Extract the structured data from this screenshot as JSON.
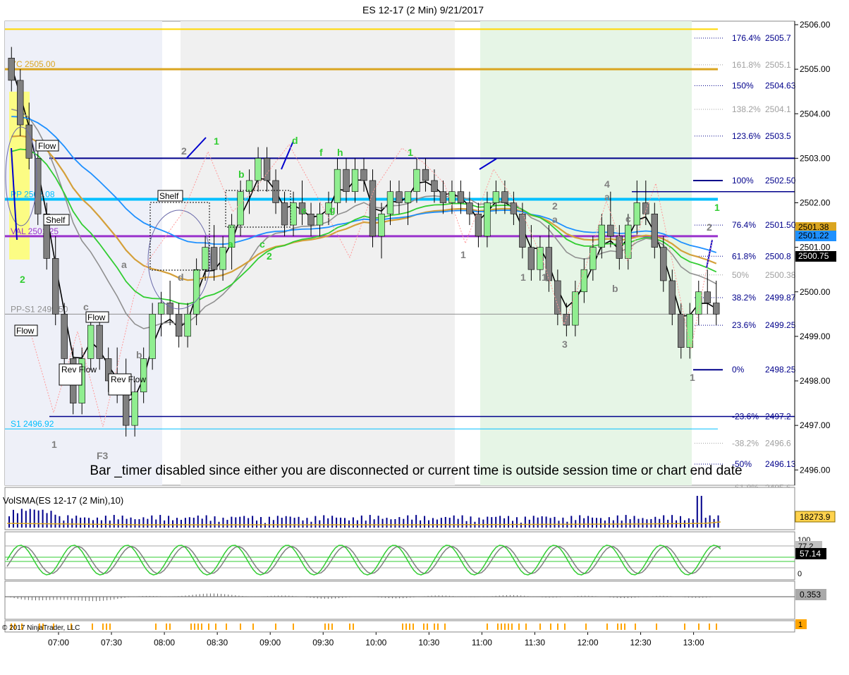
{
  "header": {
    "title": "ES 12-17 (2 Min)  9/21/2017"
  },
  "colors": {
    "up_bar": "#90ee90",
    "down_bar": "#808080",
    "fib": "#00008b",
    "cyan_line": "#00bfff",
    "purple_line": "#9932cc",
    "gold_line": "#daa520",
    "ema_fast": "#000000",
    "ema_green": "#32cd32",
    "ema_blue": "#1e90ff",
    "ema_gold": "#d4a03a",
    "ema_gray": "#909090"
  },
  "chart_data": {
    "type": "candlestick",
    "instrument": "ES 12-17 (2 Min)",
    "date": "9/21/2017",
    "ylim": [
      2495.75,
      2506.0
    ],
    "x_ticks": [
      "07:00",
      "07:30",
      "08:00",
      "08:30",
      "09:00",
      "09:30",
      "10:00",
      "10:30",
      "11:00",
      "11:30",
      "12:00",
      "12:30",
      "13:00"
    ],
    "y_ticks": [
      {
        "v": 2506,
        "label": "2506.00"
      },
      {
        "v": 2505,
        "label": "2505.00"
      },
      {
        "v": 2504,
        "label": "2504.00"
      },
      {
        "v": 2503,
        "label": "2503.00"
      },
      {
        "v": 2502,
        "label": "2502.00"
      },
      {
        "v": 2501,
        "label": "2501.00"
      },
      {
        "v": 2500,
        "label": "2500.00"
      },
      {
        "v": 2499,
        "label": "2499.00"
      },
      {
        "v": 2498,
        "label": "2498.00"
      },
      {
        "v": 2497,
        "label": "2497.00"
      },
      {
        "v": 2496,
        "label": "2496.00"
      }
    ],
    "price_tags": [
      {
        "v": 2501.38,
        "label": "2501.38",
        "bg": "#daa520",
        "fg": "#000000"
      },
      {
        "v": 2501.22,
        "label": "2501.22",
        "bg": "#1e90ff",
        "fg": "#000000"
      },
      {
        "v": 2500.75,
        "label": "2500.75",
        "bg": "#000000",
        "fg": "#ffffff"
      }
    ],
    "levels": [
      {
        "label": "YC 2505.00",
        "v": 2505.0,
        "color": "#daa520"
      },
      {
        "label": "PP 2502.08",
        "v": 2502.08,
        "color": "#00bfff"
      },
      {
        "label": "VAL 2501.25",
        "v": 2501.25,
        "color": "#9932cc"
      },
      {
        "label": "PP-S1 2499.50",
        "v": 2499.5,
        "color": "#909090"
      },
      {
        "label": "S1 2496.92",
        "v": 2496.92,
        "color": "#00bfff"
      }
    ],
    "fib_levels": [
      {
        "pct": "176.4%",
        "price": "2505.7"
      },
      {
        "pct": "161.8%",
        "price": "2505.1"
      },
      {
        "pct": "150%",
        "price": "2504.63"
      },
      {
        "pct": "138.2%",
        "price": "2504.1"
      },
      {
        "pct": "123.6%",
        "price": "2503.5"
      },
      {
        "pct": "100%",
        "price": "2502.50"
      },
      {
        "pct": "76.4%",
        "price": "2501.50"
      },
      {
        "pct": "61.8%",
        "price": "2500.8"
      },
      {
        "pct": "50%",
        "price": "2500.38"
      },
      {
        "pct": "38.2%",
        "price": "2499.87"
      },
      {
        "pct": "23.6%",
        "price": "2499.25"
      },
      {
        "pct": "0%",
        "price": "2498.25"
      },
      {
        "pct": "-23.6%",
        "price": "2497.2"
      },
      {
        "pct": "-38.2%",
        "price": "2496.6"
      },
      {
        "pct": "-50%",
        "price": "2496.13"
      },
      {
        "pct": "-61.8%",
        "price": "2495.6"
      }
    ],
    "annotations": [
      "Flow",
      "Shelf",
      "Shelf",
      "Flow",
      "Flow",
      "Rev Flow",
      "Rev Flow",
      "F3",
      "a",
      "b",
      "c",
      "d",
      "e",
      "f",
      "g",
      "h",
      "1",
      "2",
      "3",
      "4"
    ],
    "candles": [
      {
        "o": 2505.25,
        "h": 2505.5,
        "l": 2504.5,
        "c": 2504.75
      },
      {
        "o": 2504.75,
        "h": 2505.0,
        "l": 2503.5,
        "c": 2503.75
      },
      {
        "o": 2503.75,
        "h": 2504.25,
        "l": 2502.75,
        "c": 2503.0
      },
      {
        "o": 2503.0,
        "h": 2503.25,
        "l": 2501.5,
        "c": 2501.75
      },
      {
        "o": 2501.75,
        "h": 2502.0,
        "l": 2500.5,
        "c": 2500.75
      },
      {
        "o": 2500.75,
        "h": 2501.25,
        "l": 2499.25,
        "c": 2499.5
      },
      {
        "o": 2499.5,
        "h": 2499.75,
        "l": 2498.25,
        "c": 2498.5
      },
      {
        "o": 2498.5,
        "h": 2498.75,
        "l": 2497.25,
        "c": 2497.5
      },
      {
        "o": 2497.5,
        "h": 2498.75,
        "l": 2497.25,
        "c": 2498.5
      },
      {
        "o": 2498.5,
        "h": 2499.5,
        "l": 2498.25,
        "c": 2499.25
      },
      {
        "o": 2499.25,
        "h": 2499.5,
        "l": 2498.25,
        "c": 2498.5
      },
      {
        "o": 2498.5,
        "h": 2498.75,
        "l": 2497.75,
        "c": 2498.0
      },
      {
        "o": 2498.0,
        "h": 2498.75,
        "l": 2497.5,
        "c": 2497.75
      },
      {
        "o": 2497.75,
        "h": 2498.5,
        "l": 2496.75,
        "c": 2497.0
      },
      {
        "o": 2497.0,
        "h": 2498.0,
        "l": 2496.75,
        "c": 2497.75
      },
      {
        "o": 2497.75,
        "h": 2498.75,
        "l": 2497.5,
        "c": 2498.5
      },
      {
        "o": 2498.5,
        "h": 2499.75,
        "l": 2498.25,
        "c": 2499.5
      },
      {
        "o": 2499.5,
        "h": 2500.0,
        "l": 2499.0,
        "c": 2499.75
      },
      {
        "o": 2499.75,
        "h": 2500.25,
        "l": 2499.25,
        "c": 2499.5
      },
      {
        "o": 2499.5,
        "h": 2499.75,
        "l": 2498.75,
        "c": 2499.0
      },
      {
        "o": 2499.0,
        "h": 2499.75,
        "l": 2498.75,
        "c": 2499.5
      },
      {
        "o": 2499.5,
        "h": 2500.75,
        "l": 2499.25,
        "c": 2500.5
      },
      {
        "o": 2500.5,
        "h": 2501.25,
        "l": 2500.25,
        "c": 2501.0
      },
      {
        "o": 2501.0,
        "h": 2501.5,
        "l": 2500.25,
        "c": 2500.5
      },
      {
        "o": 2500.5,
        "h": 2501.25,
        "l": 2500.25,
        "c": 2501.0
      },
      {
        "o": 2501.0,
        "h": 2501.75,
        "l": 2500.5,
        "c": 2501.5
      },
      {
        "o": 2501.5,
        "h": 2502.5,
        "l": 2501.25,
        "c": 2502.25
      },
      {
        "o": 2502.25,
        "h": 2502.75,
        "l": 2501.75,
        "c": 2502.5
      },
      {
        "o": 2502.5,
        "h": 2503.25,
        "l": 2502.25,
        "c": 2503.0
      },
      {
        "o": 2503.0,
        "h": 2503.25,
        "l": 2502.25,
        "c": 2502.5
      },
      {
        "o": 2502.5,
        "h": 2502.75,
        "l": 2501.75,
        "c": 2502.0
      },
      {
        "o": 2502.0,
        "h": 2502.25,
        "l": 2501.25,
        "c": 2501.5
      },
      {
        "o": 2501.5,
        "h": 2502.25,
        "l": 2501.25,
        "c": 2502.0
      },
      {
        "o": 2502.0,
        "h": 2502.5,
        "l": 2501.5,
        "c": 2501.75
      },
      {
        "o": 2501.75,
        "h": 2502.0,
        "l": 2501.25,
        "c": 2501.5
      },
      {
        "o": 2501.5,
        "h": 2502.0,
        "l": 2501.25,
        "c": 2501.75
      },
      {
        "o": 2501.75,
        "h": 2502.25,
        "l": 2501.5,
        "c": 2502.0
      },
      {
        "o": 2502.0,
        "h": 2503.0,
        "l": 2501.75,
        "c": 2502.75
      },
      {
        "o": 2502.75,
        "h": 2503.0,
        "l": 2502.0,
        "c": 2502.25
      },
      {
        "o": 2502.25,
        "h": 2503.0,
        "l": 2502.0,
        "c": 2502.75
      },
      {
        "o": 2502.75,
        "h": 2503.0,
        "l": 2502.25,
        "c": 2502.5
      },
      {
        "o": 2502.5,
        "h": 2502.75,
        "l": 2501.0,
        "c": 2501.25
      },
      {
        "o": 2501.25,
        "h": 2502.0,
        "l": 2500.75,
        "c": 2501.75
      },
      {
        "o": 2501.75,
        "h": 2502.5,
        "l": 2501.5,
        "c": 2502.25
      },
      {
        "o": 2502.25,
        "h": 2502.5,
        "l": 2501.75,
        "c": 2502.0
      },
      {
        "o": 2502.0,
        "h": 2502.25,
        "l": 2501.5,
        "c": 2502.25
      },
      {
        "o": 2502.25,
        "h": 2503.0,
        "l": 2502.0,
        "c": 2502.75
      },
      {
        "o": 2502.75,
        "h": 2503.0,
        "l": 2502.25,
        "c": 2502.5
      },
      {
        "o": 2502.5,
        "h": 2502.75,
        "l": 2502.0,
        "c": 2502.25
      },
      {
        "o": 2502.25,
        "h": 2502.5,
        "l": 2501.75,
        "c": 2502.0
      },
      {
        "o": 2502.0,
        "h": 2502.5,
        "l": 2501.75,
        "c": 2502.25
      },
      {
        "o": 2502.25,
        "h": 2502.5,
        "l": 2501.75,
        "c": 2502.0
      },
      {
        "o": 2502.0,
        "h": 2502.25,
        "l": 2501.5,
        "c": 2501.75
      },
      {
        "o": 2501.75,
        "h": 2502.0,
        "l": 2501.0,
        "c": 2501.25
      },
      {
        "o": 2501.25,
        "h": 2502.25,
        "l": 2501.0,
        "c": 2502.0
      },
      {
        "o": 2502.0,
        "h": 2502.5,
        "l": 2501.75,
        "c": 2502.25
      },
      {
        "o": 2502.25,
        "h": 2502.5,
        "l": 2501.75,
        "c": 2502.0
      },
      {
        "o": 2502.0,
        "h": 2502.25,
        "l": 2501.5,
        "c": 2501.75
      },
      {
        "o": 2501.75,
        "h": 2502.0,
        "l": 2500.75,
        "c": 2501.0
      },
      {
        "o": 2501.0,
        "h": 2501.5,
        "l": 2500.25,
        "c": 2500.5
      },
      {
        "o": 2500.5,
        "h": 2501.25,
        "l": 2500.25,
        "c": 2501.0
      },
      {
        "o": 2501.0,
        "h": 2501.5,
        "l": 2500.0,
        "c": 2500.25
      },
      {
        "o": 2500.25,
        "h": 2500.5,
        "l": 2499.25,
        "c": 2499.5
      },
      {
        "o": 2499.5,
        "h": 2499.75,
        "l": 2499.0,
        "c": 2499.25
      },
      {
        "o": 2499.25,
        "h": 2500.25,
        "l": 2499.0,
        "c": 2500.0
      },
      {
        "o": 2500.0,
        "h": 2500.75,
        "l": 2499.75,
        "c": 2500.5
      },
      {
        "o": 2500.5,
        "h": 2501.25,
        "l": 2500.25,
        "c": 2501.0
      },
      {
        "o": 2501.0,
        "h": 2501.75,
        "l": 2500.75,
        "c": 2501.5
      },
      {
        "o": 2501.5,
        "h": 2502.25,
        "l": 2501.0,
        "c": 2501.25
      },
      {
        "o": 2501.25,
        "h": 2501.5,
        "l": 2500.5,
        "c": 2500.75
      },
      {
        "o": 2500.75,
        "h": 2501.75,
        "l": 2500.5,
        "c": 2501.5
      },
      {
        "o": 2501.5,
        "h": 2502.5,
        "l": 2501.25,
        "c": 2502.0
      },
      {
        "o": 2502.0,
        "h": 2502.5,
        "l": 2501.5,
        "c": 2501.75
      },
      {
        "o": 2501.75,
        "h": 2502.0,
        "l": 2500.75,
        "c": 2501.0
      },
      {
        "o": 2501.0,
        "h": 2501.25,
        "l": 2500.0,
        "c": 2500.25
      },
      {
        "o": 2500.25,
        "h": 2500.5,
        "l": 2499.25,
        "c": 2499.5
      },
      {
        "o": 2499.5,
        "h": 2499.75,
        "l": 2498.5,
        "c": 2498.75
      },
      {
        "o": 2498.75,
        "h": 2499.75,
        "l": 2498.5,
        "c": 2499.5
      },
      {
        "o": 2499.5,
        "h": 2500.25,
        "l": 2499.25,
        "c": 2500.0
      },
      {
        "o": 2500.0,
        "h": 2500.5,
        "l": 2499.5,
        "c": 2499.75
      },
      {
        "o": 2499.75,
        "h": 2500.25,
        "l": 2499.25,
        "c": 2499.5
      }
    ]
  },
  "overlays": {
    "watermark": "Bar _timer disabled since either you are disconnected or current time is outside session time or chart end date"
  },
  "panels": {
    "volume": {
      "label": "VolSMA(ES 12-17 (2 Min),10)",
      "value_tag": "18273.9"
    },
    "stochastic": {
      "ticks": [
        "100",
        "0"
      ],
      "tag1": "77.2",
      "tag2": "57.14"
    },
    "macd": {
      "value_tag": "0.353"
    },
    "events": {
      "value_tag": "1"
    }
  },
  "footer": {
    "copyright": "© 2017 NinjaTrader, LLC"
  }
}
